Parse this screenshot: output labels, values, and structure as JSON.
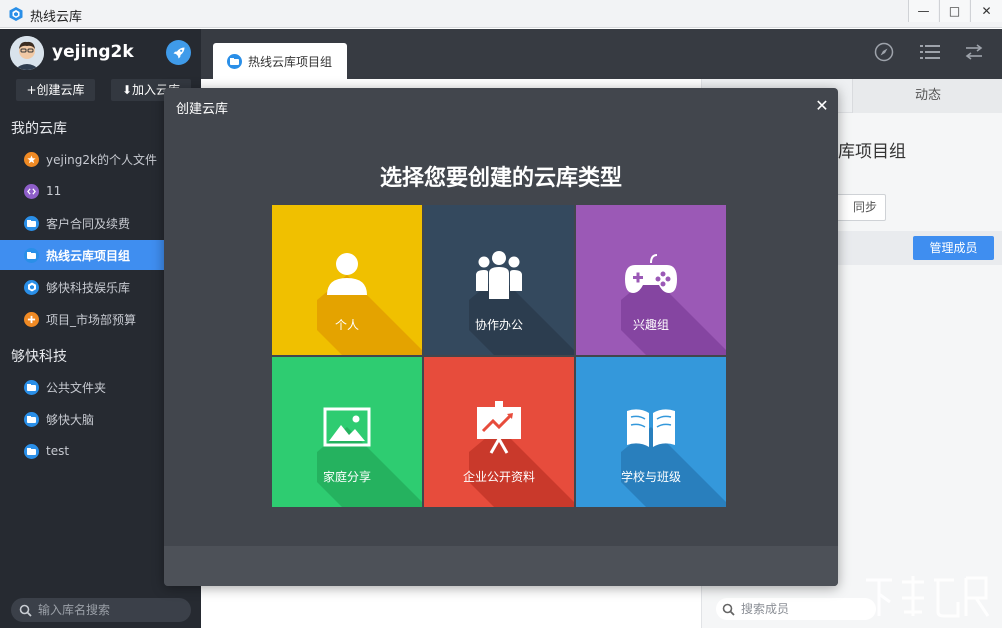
{
  "window": {
    "title": "热线云库",
    "controls": {
      "minimize": "—",
      "maximize": "□",
      "close": "✕"
    }
  },
  "sidebar": {
    "username": "yejing2k",
    "create_button": "+创建云库",
    "join_button": "⬇加入云库",
    "sections": [
      {
        "title": "我的云库",
        "items": [
          {
            "label": "yejing2k的个人文件",
            "icon": "star-icon",
            "color": "#f08a24",
            "active": false
          },
          {
            "label": "11",
            "icon": "code-icon",
            "color": "#8e5ec9",
            "active": false
          },
          {
            "label": "客户合同及续费",
            "icon": "folder-icon",
            "color": "#2a8fe8",
            "active": false
          },
          {
            "label": "热线云库项目组",
            "icon": "folder-icon",
            "color": "#2a8fe8",
            "active": true
          },
          {
            "label": "够快科技娱乐库",
            "icon": "cube-icon",
            "color": "#2a8fe8",
            "active": false
          },
          {
            "label": "项目_市场部预算",
            "icon": "plus-icon",
            "color": "#f08a24",
            "active": false
          }
        ]
      },
      {
        "title": "够快科技",
        "items": [
          {
            "label": "公共文件夹",
            "icon": "folder-icon",
            "color": "#2a8fe8",
            "active": false
          },
          {
            "label": "够快大脑",
            "icon": "folder-icon",
            "color": "#2a8fe8",
            "active": false
          },
          {
            "label": "test",
            "icon": "folder-icon",
            "color": "#2a8fe8",
            "active": false
          }
        ]
      }
    ],
    "search": {
      "placeholder": "输入库名搜索"
    }
  },
  "topbar": {
    "tab_label": "热线云库项目组"
  },
  "right_panel": {
    "tab_dynamic": "动态",
    "library_name": "库项目组",
    "sync_button": "同步",
    "manage_button": "管理成员",
    "search": {
      "placeholder": "搜索成员"
    }
  },
  "modal": {
    "title": "创建云库",
    "close": "✕",
    "heading": "选择您要创建的云库类型",
    "tiles": [
      {
        "label": "个人",
        "icon": "person-icon",
        "color": "#f0c000",
        "shadow": "#e09a00"
      },
      {
        "label": "协作办公",
        "icon": "team-icon",
        "color": "#34495e",
        "shadow": "#2a3a4b"
      },
      {
        "label": "兴趣组",
        "icon": "gamepad-icon",
        "color": "#9b59b6",
        "shadow": "#7d3f9a"
      },
      {
        "label": "家庭分享",
        "icon": "picture-icon",
        "color": "#2ecc71",
        "shadow": "#23a95a"
      },
      {
        "label": "企业公开资料",
        "icon": "presentation-icon",
        "color": "#e74c3c",
        "shadow": "#bf3326"
      },
      {
        "label": "学校与班级",
        "icon": "book-icon",
        "color": "#3498db",
        "shadow": "#2577b3"
      }
    ]
  }
}
